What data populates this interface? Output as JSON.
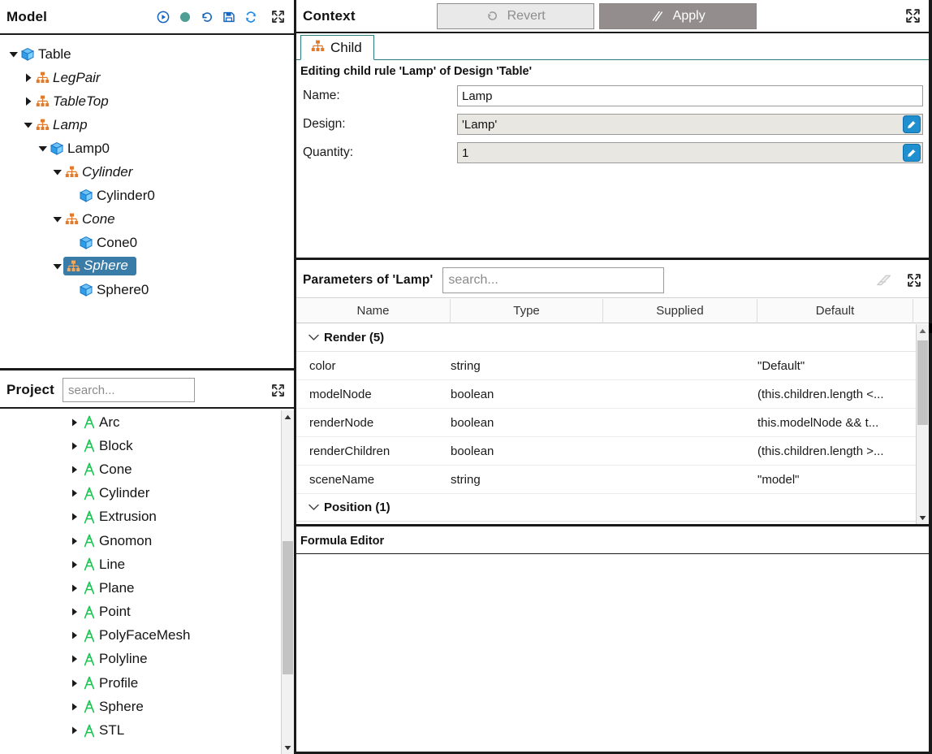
{
  "model": {
    "title": "Model",
    "toolbar": [
      {
        "name": "run-icon",
        "label": "Run"
      },
      {
        "name": "status-dot-icon",
        "label": "Status",
        "color": "#4e9e96"
      },
      {
        "name": "undo-history-icon",
        "label": "History"
      },
      {
        "name": "save-icon",
        "label": "Save"
      },
      {
        "name": "refresh-icon",
        "label": "Refresh"
      },
      {
        "name": "expand-icon",
        "label": "Expand"
      }
    ],
    "tree": [
      {
        "label": "Table",
        "depth": 0,
        "icon": "cube-icon",
        "twisty": "down",
        "italic": false,
        "selected": false
      },
      {
        "label": "LegPair",
        "depth": 1,
        "icon": "rule-icon",
        "twisty": "right",
        "italic": true,
        "selected": false
      },
      {
        "label": "TableTop",
        "depth": 1,
        "icon": "rule-icon",
        "twisty": "right",
        "italic": true,
        "selected": false
      },
      {
        "label": "Lamp",
        "depth": 1,
        "icon": "rule-icon",
        "twisty": "down",
        "italic": true,
        "selected": false
      },
      {
        "label": "Lamp0",
        "depth": 2,
        "icon": "cube-icon",
        "twisty": "down",
        "italic": false,
        "selected": false
      },
      {
        "label": "Cylinder",
        "depth": 3,
        "icon": "rule-icon",
        "twisty": "down",
        "italic": true,
        "selected": false
      },
      {
        "label": "Cylinder0",
        "depth": 4,
        "icon": "cube-icon",
        "twisty": "none",
        "italic": false,
        "selected": false
      },
      {
        "label": "Cone",
        "depth": 3,
        "icon": "rule-icon",
        "twisty": "down",
        "italic": true,
        "selected": false
      },
      {
        "label": "Cone0",
        "depth": 4,
        "icon": "cube-icon",
        "twisty": "none",
        "italic": false,
        "selected": false
      },
      {
        "label": "Sphere",
        "depth": 3,
        "icon": "rule-icon",
        "twisty": "down",
        "italic": true,
        "selected": true
      },
      {
        "label": "Sphere0",
        "depth": 4,
        "icon": "cube-icon",
        "twisty": "none",
        "italic": false,
        "selected": false
      }
    ]
  },
  "project": {
    "title": "Project",
    "search_placeholder": "search...",
    "search_value": "",
    "expand_label": "Expand",
    "items": [
      {
        "label": "Arc",
        "icon": "design-icon"
      },
      {
        "label": "Block",
        "icon": "design-icon"
      },
      {
        "label": "Cone",
        "icon": "design-icon"
      },
      {
        "label": "Cylinder",
        "icon": "design-icon"
      },
      {
        "label": "Extrusion",
        "icon": "design-icon"
      },
      {
        "label": "Gnomon",
        "icon": "design-icon"
      },
      {
        "label": "Line",
        "icon": "design-icon"
      },
      {
        "label": "Plane",
        "icon": "design-icon"
      },
      {
        "label": "Point",
        "icon": "design-icon"
      },
      {
        "label": "PolyFaceMesh",
        "icon": "design-icon"
      },
      {
        "label": "Polyline",
        "icon": "design-icon"
      },
      {
        "label": "Profile",
        "icon": "design-icon"
      },
      {
        "label": "Sphere",
        "icon": "design-icon"
      },
      {
        "label": "STL",
        "icon": "design-icon"
      }
    ]
  },
  "context": {
    "title": "Context",
    "revert_label": "Revert",
    "apply_label": "Apply",
    "expand_label": "Expand",
    "tab_label": "Child",
    "editing_line": "Editing child rule 'Lamp' of Design 'Table'",
    "fields": [
      {
        "label": "Name:",
        "value": "Lamp",
        "readonly": false,
        "pencil": false
      },
      {
        "label": "Design:",
        "value": "'Lamp'",
        "readonly": true,
        "pencil": true
      },
      {
        "label": "Quantity:",
        "value": "1",
        "readonly": true,
        "pencil": true
      }
    ]
  },
  "parameters": {
    "title": "Parameters of 'Lamp'",
    "search_placeholder": "search...",
    "search_value": "",
    "clear_label": "Clear",
    "expand_label": "Expand",
    "columns": [
      "Name",
      "Type",
      "Supplied",
      "Default"
    ],
    "groups": [
      {
        "label": "Render (5)",
        "expanded": true,
        "rows": [
          {
            "name": "color",
            "type": "string",
            "supplied": "",
            "default": "\"Default\""
          },
          {
            "name": "modelNode",
            "type": "boolean",
            "supplied": "",
            "default": "(this.children.length <..."
          },
          {
            "name": "renderNode",
            "type": "boolean",
            "supplied": "",
            "default": "this.modelNode && t..."
          },
          {
            "name": "renderChildren",
            "type": "boolean",
            "supplied": "",
            "default": "(this.children.length >..."
          },
          {
            "name": "sceneName",
            "type": "string",
            "supplied": "",
            "default": "\"model\""
          }
        ]
      },
      {
        "label": "Position (1)",
        "expanded": true,
        "rows": []
      }
    ]
  },
  "formula": {
    "title": "Formula Editor",
    "content": ""
  }
}
